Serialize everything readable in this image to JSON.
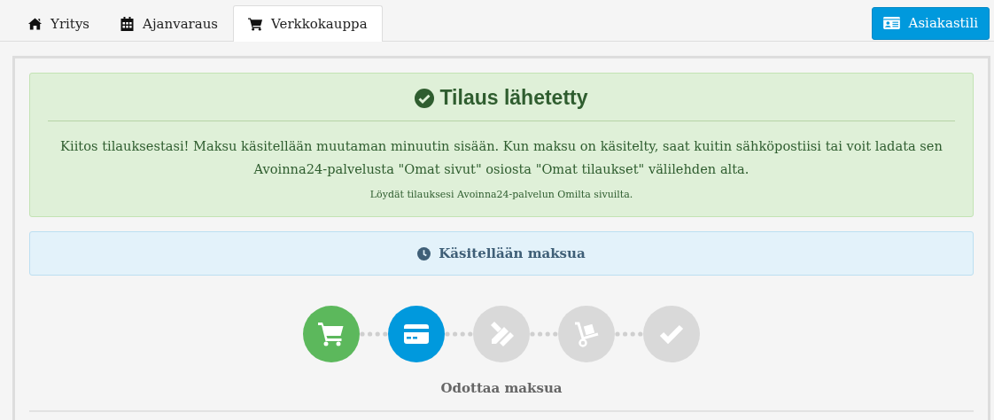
{
  "tabs": [
    {
      "label": "Yritys",
      "kind": "home",
      "selected": false
    },
    {
      "label": "Ajanvaraus",
      "kind": "calendar",
      "selected": false
    },
    {
      "label": "Verkkokauppa",
      "kind": "cart",
      "selected": true
    }
  ],
  "account_button": {
    "label": "Asiakastili"
  },
  "success": {
    "title": "Tilaus lähetetty",
    "message": "Kiitos tilauksestasi! Maksu käsitellään muutaman minuutin sisään. Kun maksu on käsitelty, saat kuitin sähköpostiisi tai voit ladata sen Avoinna24-palvelusta \"Omat sivut\" osiosta \"Omat tilaukset\" välilehden alta.",
    "note": "Löydät tilauksesi Avoinna24-palvelun Omilta sivuilta."
  },
  "status": {
    "label": "Käsitellään maksua"
  },
  "steps": [
    {
      "kind": "cart",
      "done": true,
      "selected": false
    },
    {
      "kind": "card",
      "done": false,
      "selected": true
    },
    {
      "kind": "tools",
      "done": false,
      "selected": false
    },
    {
      "kind": "dolly",
      "done": false,
      "selected": false
    },
    {
      "kind": "check",
      "done": false,
      "selected": false
    }
  ],
  "step_caption": "Odottaa maksua"
}
